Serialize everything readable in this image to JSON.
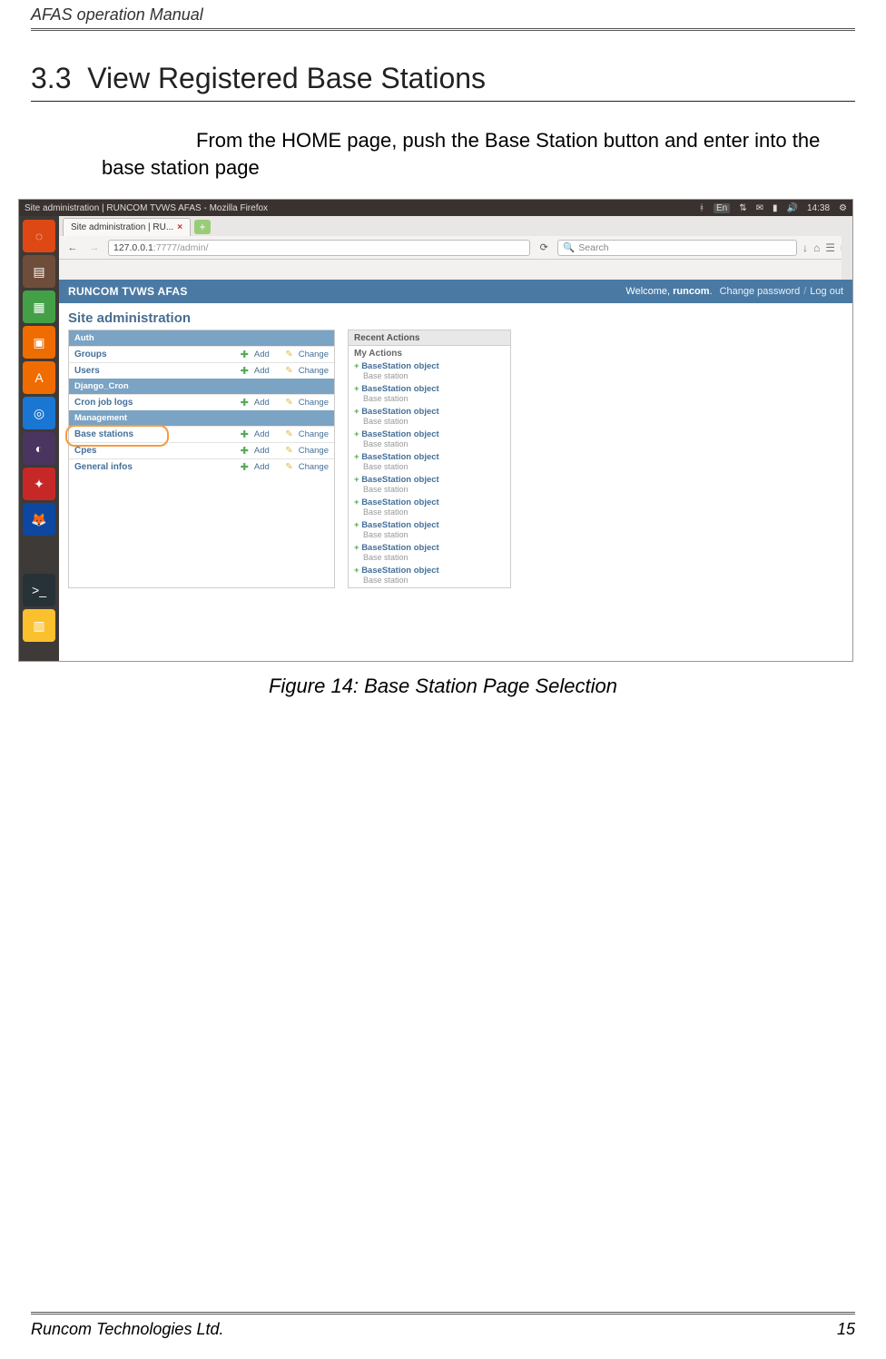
{
  "header": {
    "title": "AFAS operation Manual"
  },
  "section": {
    "number": "3.3",
    "title": "View Registered Base Stations",
    "body": "From the HOME page, push the Base Station button and enter into the base station page"
  },
  "figure": {
    "caption": "Figure 14: Base Station Page Selection"
  },
  "footer": {
    "left": "Runcom Technologies Ltd.",
    "right": "15"
  },
  "screenshot": {
    "sysbar": {
      "title": "Site administration | RUNCOM TVWS AFAS - Mozilla Firefox",
      "lang": "En",
      "time": "14:38",
      "gear": "⚙"
    },
    "browser": {
      "tab": "Site administration | RU...",
      "url_host": "127.0.0.1",
      "url_rest": ":7777/admin/",
      "search_placeholder": "Search"
    },
    "admin": {
      "brand": "RUNCOM TVWS AFAS",
      "welcome": "Welcome,",
      "user": "runcom",
      "change_pw": "Change password",
      "logout": "Log out",
      "page_title": "Site administration",
      "groups": {
        "auth": {
          "label": "Auth",
          "rows": [
            "Groups",
            "Users"
          ]
        },
        "django_cron": {
          "label": "Django_Cron",
          "rows": [
            "Cron job logs"
          ]
        },
        "management": {
          "label": "Management",
          "rows": [
            "Base stations",
            "Cpes",
            "General infos"
          ]
        }
      },
      "add": "Add",
      "change": "Change",
      "recent_label": "Recent Actions",
      "my_actions": "My Actions",
      "action_title": "BaseStation object",
      "action_sub": "Base station"
    }
  }
}
